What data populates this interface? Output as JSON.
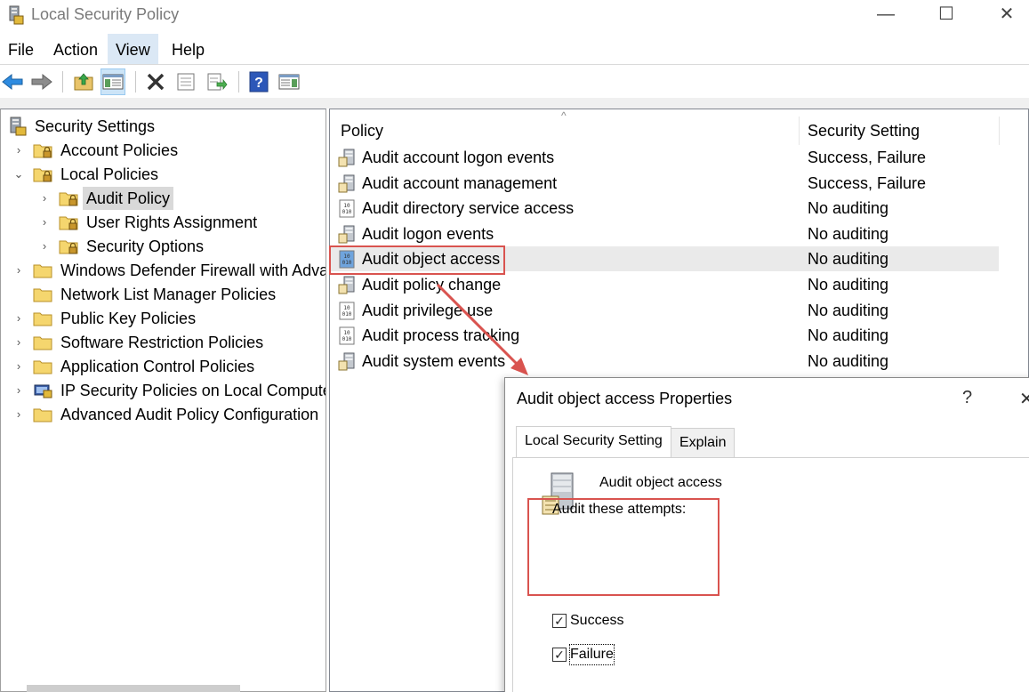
{
  "window": {
    "title": "Local Security Policy",
    "minimize_glyph": "—",
    "maximize_glyph": "☐",
    "close_glyph": "✕"
  },
  "menu": {
    "file": "File",
    "action": "Action",
    "view": "View",
    "help": "Help",
    "active": "View"
  },
  "toolbar": {
    "items": [
      "back-icon",
      "forward-icon",
      "up-folder-icon",
      "show-hide-tree-icon",
      "delete-icon",
      "properties-icon",
      "export-list-icon",
      "help-icon",
      "show-hide-action-pane-icon"
    ]
  },
  "tree": {
    "root": "Security Settings",
    "items": [
      {
        "label": "Account Policies",
        "expander": "›"
      },
      {
        "label": "Local Policies",
        "expander": "⌄"
      },
      {
        "label": "Audit Policy",
        "expander": "›",
        "selected": true
      },
      {
        "label": "User Rights Assignment",
        "expander": "›"
      },
      {
        "label": "Security Options",
        "expander": "›"
      },
      {
        "label": "Windows Defender Firewall with Advanced Security",
        "expander": "›"
      },
      {
        "label": "Network List Manager Policies",
        "expander": ""
      },
      {
        "label": "Public Key Policies",
        "expander": "›"
      },
      {
        "label": "Software Restriction Policies",
        "expander": "›"
      },
      {
        "label": "Application Control Policies",
        "expander": "›"
      },
      {
        "label": "IP Security Policies on Local Computer",
        "expander": "›"
      },
      {
        "label": "Advanced Audit Policy Configuration",
        "expander": "›"
      }
    ]
  },
  "list": {
    "sort_caret": "^",
    "columns": {
      "policy": "Policy",
      "setting": "Security Setting"
    },
    "rows": [
      {
        "policy": "Audit account logon events",
        "setting": "Success, Failure"
      },
      {
        "policy": "Audit account management",
        "setting": "Success, Failure"
      },
      {
        "policy": "Audit directory service access",
        "setting": "No auditing"
      },
      {
        "policy": "Audit logon events",
        "setting": "No auditing"
      },
      {
        "policy": "Audit object access",
        "setting": "No auditing",
        "highlighted": true
      },
      {
        "policy": "Audit policy change",
        "setting": "No auditing"
      },
      {
        "policy": "Audit privilege use",
        "setting": "No auditing"
      },
      {
        "policy": "Audit process tracking",
        "setting": "No auditing"
      },
      {
        "policy": "Audit system events",
        "setting": "No auditing"
      }
    ]
  },
  "dialog": {
    "title": "Audit object access Properties",
    "help_glyph": "?",
    "close_glyph": "✕",
    "tabs": [
      "Local Security Setting",
      "Explain"
    ],
    "active_tab": "Local Security Setting",
    "policy_name": "Audit object access",
    "attempts_label": "Audit these attempts:",
    "success_label": "Success",
    "success_checked": true,
    "failure_label": "Failure",
    "failure_checked": true,
    "check_glyph": "✓"
  },
  "colors": {
    "highlight_border": "#d9534f",
    "menu_active_bg": "#dbe8f5",
    "selection_bg": "#d9d9d9"
  }
}
